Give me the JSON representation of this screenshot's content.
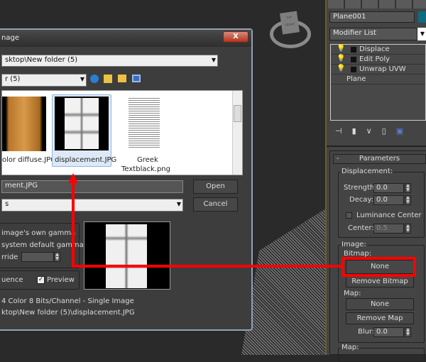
{
  "viewport": {
    "viewcube": {
      "top": "TOP",
      "front": "FRONT"
    }
  },
  "dialog": {
    "title": "nage",
    "close_label": "X",
    "path_combo": "sktop\\New folder (5)",
    "look_in": "r (5)",
    "toolbar_icons": [
      "back-icon",
      "up-folder-icon",
      "new-folder-icon",
      "view-menu-icon"
    ],
    "files": [
      {
        "name": "olor diffuse.JPG",
        "selected": false
      },
      {
        "name": "displacement.JPG",
        "selected": true
      },
      {
        "name": "Greek",
        "name2": "Textblack.png",
        "selected": false
      }
    ],
    "file_name": "ment.JPG",
    "file_type": "s",
    "open_label": "Open",
    "cancel_label": "Cancel",
    "gamma": {
      "own": "image's own gamma",
      "system": "system default gamma",
      "override": "rride"
    },
    "sequence_label": "uence",
    "preview_label": "Preview",
    "preview_checked": true,
    "info": "4 Color 8 Bits/Channel - Single Image",
    "info_path": "ktop\\New folder (5)\\displacement.JPG"
  },
  "panel": {
    "object_name": "Plane001",
    "object_color": "#0e6b80",
    "modifier_list": "Modifier List",
    "stack": [
      "Displace",
      "Edit Poly",
      "Unwrap UVW"
    ],
    "base": "Plane",
    "rollout": "Parameters",
    "rollout_toggle": "-",
    "displacement": {
      "label": "Displacement:",
      "strength_label": "Strength:",
      "strength": "0.0",
      "decay_label": "Decay:",
      "decay": "0.0",
      "lum_label": "Luminance Center",
      "center_label": "Center:",
      "center": "0.5"
    },
    "image": {
      "label": "Image:",
      "bitmap_label": "Bitmap:",
      "bitmap_btn": "None",
      "remove_bitmap": "Remove Bitmap",
      "map_label": "Map:",
      "map_btn": "None",
      "remove_map": "Remove Map",
      "blur_label": "Blur:",
      "blur": "0.0"
    },
    "map_group": "Map:"
  },
  "annotation_color": "#ff0000"
}
